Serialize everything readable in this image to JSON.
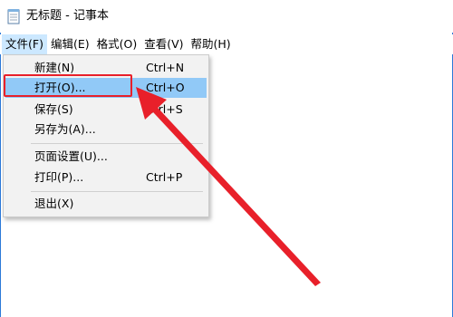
{
  "window": {
    "title": "无标题 - 记事本",
    "icon": "notepad-icon"
  },
  "menubar": {
    "items": [
      {
        "label": "文件(F)",
        "active": true
      },
      {
        "label": "编辑(E)"
      },
      {
        "label": "格式(O)"
      },
      {
        "label": "查看(V)"
      },
      {
        "label": "帮助(H)"
      }
    ]
  },
  "file_menu": {
    "items": [
      {
        "label": "新建(N)",
        "shortcut": "Ctrl+N"
      },
      {
        "label": "打开(O)...",
        "shortcut": "Ctrl+O",
        "highlighted": true
      },
      {
        "label": "保存(S)",
        "shortcut": "Ctrl+S"
      },
      {
        "label": "另存为(A)...",
        "shortcut": ""
      },
      {
        "label": "页面设置(U)...",
        "shortcut": ""
      },
      {
        "label": "打印(P)...",
        "shortcut": "Ctrl+P"
      },
      {
        "label": "退出(X)",
        "shortcut": ""
      }
    ]
  },
  "annotation": {
    "color": "#e8202a",
    "target": "打开(O)..."
  },
  "colors": {
    "menu_highlight": "#91c9f7",
    "menubar_active": "#cce8ff",
    "menu_background": "#f2f2f2"
  }
}
